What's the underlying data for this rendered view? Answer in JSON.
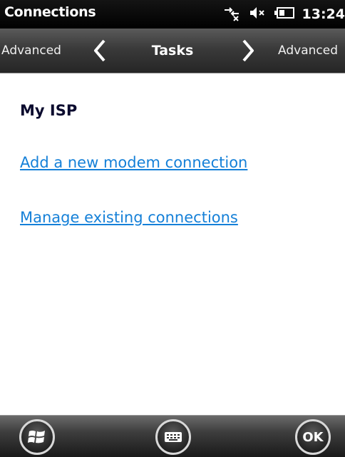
{
  "titlebar": {
    "app_title": "Connections",
    "time": "13:24",
    "icons": [
      "connectivity-icon",
      "speaker-muted-icon",
      "battery-icon"
    ]
  },
  "tabs": {
    "previous": "Advanced",
    "current": "Tasks",
    "next": "Advanced"
  },
  "content": {
    "heading": "My ISP",
    "links": [
      "Add a new modem connection",
      "Manage existing connections"
    ]
  },
  "bottombar": {
    "start_icon": "windows-start-icon",
    "keyboard_icon": "keyboard-icon",
    "ok_label": "OK"
  },
  "colors": {
    "link": "#1580d8",
    "heading": "#0b0b2e",
    "bar_dark": "#000000"
  }
}
